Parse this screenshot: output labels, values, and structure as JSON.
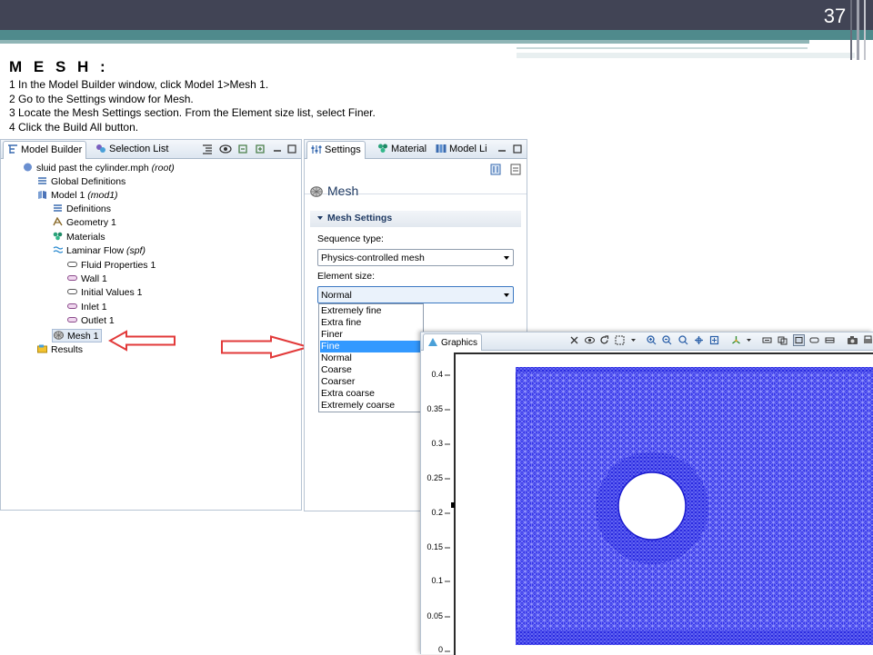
{
  "slide": {
    "number": "37",
    "title": "M E S H  :",
    "steps": [
      "1  In the Model Builder window, click Model 1>Mesh 1.",
      "2  Go to the Settings window for Mesh.",
      "3  Locate the Mesh Settings section. From the Element size list, select Finer.",
      "4  Click the Build All button."
    ]
  },
  "model_builder": {
    "tabs": [
      "Model Builder",
      "Selection List"
    ],
    "tree": [
      {
        "label": "sluid past the cylinder.mph",
        "suffix": "(root)"
      },
      {
        "label": "Global Definitions",
        "suffix": ""
      },
      {
        "label": "Model 1",
        "suffix": "(mod1)"
      },
      {
        "label": "Definitions",
        "suffix": ""
      },
      {
        "label": "Geometry 1",
        "suffix": ""
      },
      {
        "label": "Materials",
        "suffix": ""
      },
      {
        "label": "Laminar Flow",
        "suffix": "(spf)"
      },
      {
        "label": "Fluid Properties 1",
        "suffix": ""
      },
      {
        "label": "Wall 1",
        "suffix": ""
      },
      {
        "label": "Initial Values 1",
        "suffix": ""
      },
      {
        "label": "Inlet 1",
        "suffix": ""
      },
      {
        "label": "Outlet 1",
        "suffix": ""
      },
      {
        "label": "Mesh 1",
        "suffix": ""
      },
      {
        "label": "Results",
        "suffix": ""
      }
    ]
  },
  "settings": {
    "tabs": [
      "Settings",
      "Material",
      "Model Li"
    ],
    "header": "Mesh",
    "section": "Mesh Settings",
    "sequence_label": "Sequence type:",
    "sequence_value": "Physics-controlled mesh",
    "element_label": "Element size:",
    "element_value": "Normal",
    "options": [
      "Extremely fine",
      "Extra fine",
      "Finer",
      "Fine",
      "Normal",
      "Coarse",
      "Coarser",
      "Extra coarse",
      "Extremely coarse"
    ],
    "selected_option": "Fine"
  },
  "graphics": {
    "tab": "Graphics",
    "y_ticks": [
      "0.4",
      "0.35",
      "0.3",
      "0.25",
      "0.2",
      "0.15",
      "0.1",
      "0.05",
      "0"
    ]
  },
  "colors": {
    "header_dark": "#414455",
    "header_teal": "#4f8a8c",
    "mesh_blue": "#2a2ae6",
    "arrow_red": "#e23a3a",
    "selection_blue": "#3399ff"
  }
}
